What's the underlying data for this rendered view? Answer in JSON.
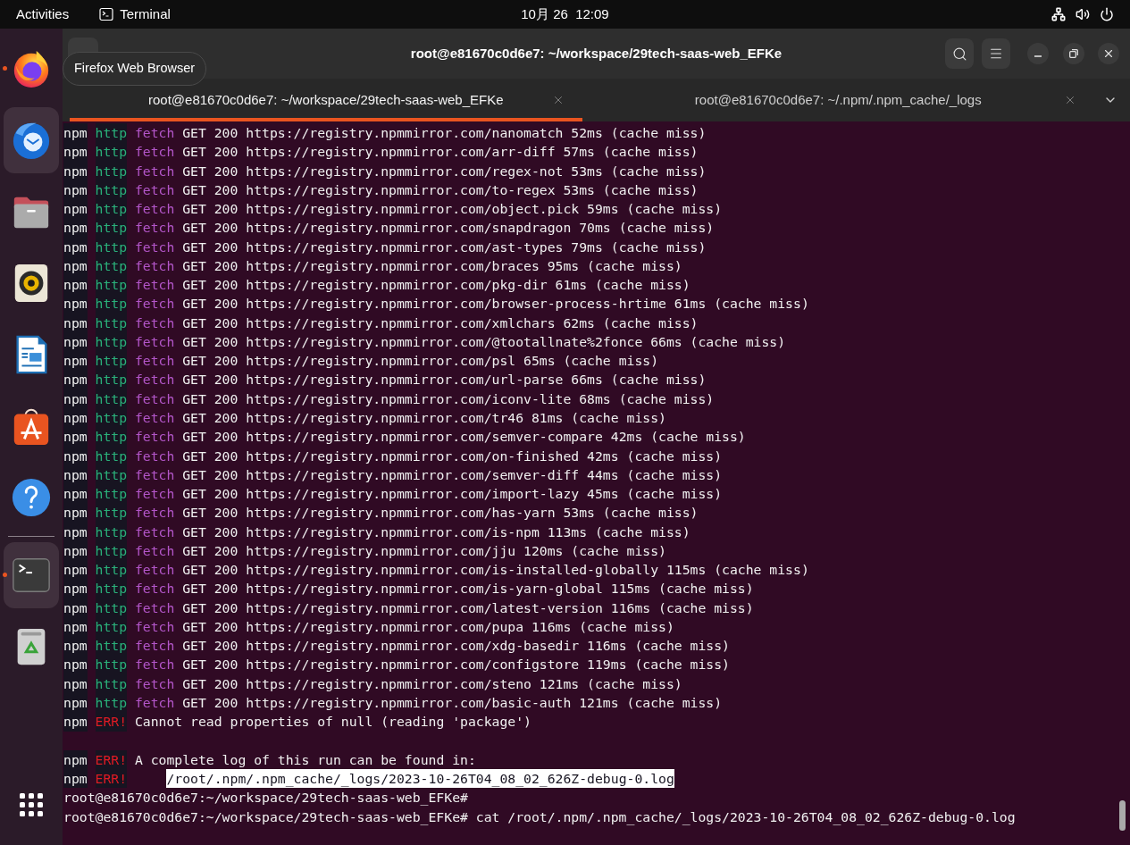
{
  "top_bar": {
    "activities": "Activities",
    "app": "Terminal",
    "clock": "10月 26  12:09"
  },
  "dock": {
    "tooltip": "Firefox Web Browser",
    "items": [
      {
        "kind": "firefox",
        "running": true,
        "highlighted": false
      },
      {
        "kind": "thunderbird",
        "running": false,
        "highlighted": true
      },
      {
        "kind": "files",
        "running": false,
        "highlighted": false
      },
      {
        "kind": "rhythmbox",
        "running": false,
        "highlighted": false
      },
      {
        "kind": "writer",
        "running": false,
        "highlighted": false
      },
      {
        "kind": "app_center",
        "running": false,
        "highlighted": false
      },
      {
        "kind": "help",
        "running": false,
        "highlighted": false
      },
      {
        "kind": "separator"
      },
      {
        "kind": "terminal",
        "running": true,
        "highlighted": true
      },
      {
        "kind": "trash",
        "running": false,
        "highlighted": false
      }
    ]
  },
  "window": {
    "title": "root@e81670c0d6e7: ~/workspace/29tech-saas-web_EFKe"
  },
  "tabs": [
    {
      "label": "root@e81670c0d6e7: ~/workspace/29tech-saas-web_EFKe",
      "selected": true
    },
    {
      "label": "root@e81670c0d6e7: ~/.npm/.npm_cache/_logs",
      "selected": false
    }
  ],
  "terminal": {
    "lines": [
      {
        "kind": "http",
        "prefix": "npm",
        "tag": "http",
        "verb": "fetch",
        "text": "GET 200 https://registry.npmmirror.com/nanomatch 52ms (cache miss)"
      },
      {
        "kind": "http",
        "prefix": "npm",
        "tag": "http",
        "verb": "fetch",
        "text": "GET 200 https://registry.npmmirror.com/arr-diff 57ms (cache miss)"
      },
      {
        "kind": "http",
        "prefix": "npm",
        "tag": "http",
        "verb": "fetch",
        "text": "GET 200 https://registry.npmmirror.com/regex-not 53ms (cache miss)"
      },
      {
        "kind": "http",
        "prefix": "npm",
        "tag": "http",
        "verb": "fetch",
        "text": "GET 200 https://registry.npmmirror.com/to-regex 53ms (cache miss)"
      },
      {
        "kind": "http",
        "prefix": "npm",
        "tag": "http",
        "verb": "fetch",
        "text": "GET 200 https://registry.npmmirror.com/object.pick 59ms (cache miss)"
      },
      {
        "kind": "http",
        "prefix": "npm",
        "tag": "http",
        "verb": "fetch",
        "text": "GET 200 https://registry.npmmirror.com/snapdragon 70ms (cache miss)"
      },
      {
        "kind": "http",
        "prefix": "npm",
        "tag": "http",
        "verb": "fetch",
        "text": "GET 200 https://registry.npmmirror.com/ast-types 79ms (cache miss)"
      },
      {
        "kind": "http",
        "prefix": "npm",
        "tag": "http",
        "verb": "fetch",
        "text": "GET 200 https://registry.npmmirror.com/braces 95ms (cache miss)"
      },
      {
        "kind": "http",
        "prefix": "npm",
        "tag": "http",
        "verb": "fetch",
        "text": "GET 200 https://registry.npmmirror.com/pkg-dir 61ms (cache miss)"
      },
      {
        "kind": "http",
        "prefix": "npm",
        "tag": "http",
        "verb": "fetch",
        "text": "GET 200 https://registry.npmmirror.com/browser-process-hrtime 61ms (cache miss)"
      },
      {
        "kind": "http",
        "prefix": "npm",
        "tag": "http",
        "verb": "fetch",
        "text": "GET 200 https://registry.npmmirror.com/xmlchars 62ms (cache miss)"
      },
      {
        "kind": "http",
        "prefix": "npm",
        "tag": "http",
        "verb": "fetch",
        "text": "GET 200 https://registry.npmmirror.com/@tootallnate%2fonce 66ms (cache miss)"
      },
      {
        "kind": "http",
        "prefix": "npm",
        "tag": "http",
        "verb": "fetch",
        "text": "GET 200 https://registry.npmmirror.com/psl 65ms (cache miss)"
      },
      {
        "kind": "http",
        "prefix": "npm",
        "tag": "http",
        "verb": "fetch",
        "text": "GET 200 https://registry.npmmirror.com/url-parse 66ms (cache miss)"
      },
      {
        "kind": "http",
        "prefix": "npm",
        "tag": "http",
        "verb": "fetch",
        "text": "GET 200 https://registry.npmmirror.com/iconv-lite 68ms (cache miss)"
      },
      {
        "kind": "http",
        "prefix": "npm",
        "tag": "http",
        "verb": "fetch",
        "text": "GET 200 https://registry.npmmirror.com/tr46 81ms (cache miss)"
      },
      {
        "kind": "http",
        "prefix": "npm",
        "tag": "http",
        "verb": "fetch",
        "text": "GET 200 https://registry.npmmirror.com/semver-compare 42ms (cache miss)"
      },
      {
        "kind": "http",
        "prefix": "npm",
        "tag": "http",
        "verb": "fetch",
        "text": "GET 200 https://registry.npmmirror.com/on-finished 42ms (cache miss)"
      },
      {
        "kind": "http",
        "prefix": "npm",
        "tag": "http",
        "verb": "fetch",
        "text": "GET 200 https://registry.npmmirror.com/semver-diff 44ms (cache miss)"
      },
      {
        "kind": "http",
        "prefix": "npm",
        "tag": "http",
        "verb": "fetch",
        "text": "GET 200 https://registry.npmmirror.com/import-lazy 45ms (cache miss)"
      },
      {
        "kind": "http",
        "prefix": "npm",
        "tag": "http",
        "verb": "fetch",
        "text": "GET 200 https://registry.npmmirror.com/has-yarn 53ms (cache miss)"
      },
      {
        "kind": "http",
        "prefix": "npm",
        "tag": "http",
        "verb": "fetch",
        "text": "GET 200 https://registry.npmmirror.com/is-npm 113ms (cache miss)"
      },
      {
        "kind": "http",
        "prefix": "npm",
        "tag": "http",
        "verb": "fetch",
        "text": "GET 200 https://registry.npmmirror.com/jju 120ms (cache miss)"
      },
      {
        "kind": "http",
        "prefix": "npm",
        "tag": "http",
        "verb": "fetch",
        "text": "GET 200 https://registry.npmmirror.com/is-installed-globally 115ms (cache miss)"
      },
      {
        "kind": "http",
        "prefix": "npm",
        "tag": "http",
        "verb": "fetch",
        "text": "GET 200 https://registry.npmmirror.com/is-yarn-global 115ms (cache miss)"
      },
      {
        "kind": "http",
        "prefix": "npm",
        "tag": "http",
        "verb": "fetch",
        "text": "GET 200 https://registry.npmmirror.com/latest-version 116ms (cache miss)"
      },
      {
        "kind": "http",
        "prefix": "npm",
        "tag": "http",
        "verb": "fetch",
        "text": "GET 200 https://registry.npmmirror.com/pupa 116ms (cache miss)"
      },
      {
        "kind": "http",
        "prefix": "npm",
        "tag": "http",
        "verb": "fetch",
        "text": "GET 200 https://registry.npmmirror.com/xdg-basedir 116ms (cache miss)"
      },
      {
        "kind": "http",
        "prefix": "npm",
        "tag": "http",
        "verb": "fetch",
        "text": "GET 200 https://registry.npmmirror.com/configstore 119ms (cache miss)"
      },
      {
        "kind": "http",
        "prefix": "npm",
        "tag": "http",
        "verb": "fetch",
        "text": "GET 200 https://registry.npmmirror.com/steno 121ms (cache miss)"
      },
      {
        "kind": "http",
        "prefix": "npm",
        "tag": "http",
        "verb": "fetch",
        "text": "GET 200 https://registry.npmmirror.com/basic-auth 121ms (cache miss)"
      },
      {
        "kind": "err",
        "prefix": "npm",
        "tag": "ERR!",
        "text": "Cannot read properties of null (reading 'package')"
      },
      {
        "kind": "blank"
      },
      {
        "kind": "err",
        "prefix": "npm",
        "tag": "ERR!",
        "text": "A complete log of this run can be found in:"
      },
      {
        "kind": "err_path",
        "prefix": "npm",
        "tag": "ERR!",
        "text": "/root/.npm/.npm_cache/_logs/2023-10-26T04_08_02_626Z-debug-0.log",
        "selected": true
      },
      {
        "kind": "prompt",
        "text": "root@e81670c0d6e7:~/workspace/29tech-saas-web_EFKe#"
      },
      {
        "kind": "prompt",
        "text": "root@e81670c0d6e7:~/workspace/29tech-saas-web_EFKe# cat /root/.npm/.npm_cache/_logs/2023-10-26T04_08_02_626Z-debug-0.log"
      }
    ]
  }
}
